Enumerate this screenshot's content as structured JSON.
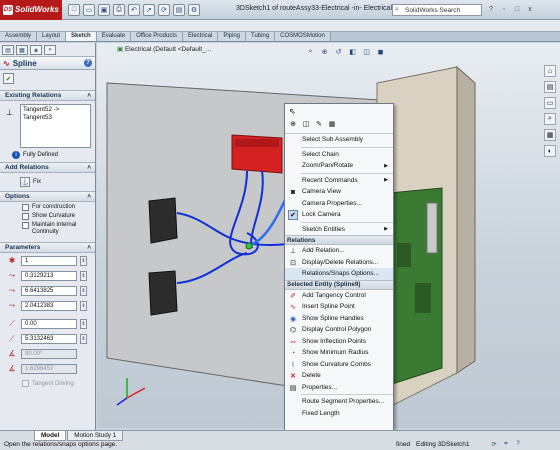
{
  "app": {
    "name": "SolidWorks",
    "document_title": "3DSketch1 of routeAssy33-Electrical -in- Electrical *",
    "search_placeholder": "SolidWorks Search",
    "window_controls": [
      "?",
      "-",
      "□",
      "x"
    ]
  },
  "command_tabs": [
    "Assembly",
    "Layout",
    "Sketch",
    "Evaluate",
    "Office Products",
    "Electrical",
    "Piping",
    "Tubing",
    "COSMOSMotion"
  ],
  "active_command_tab": "Sketch",
  "property_manager": {
    "title": "Spline",
    "existing_relations": {
      "title": "Existing Relations",
      "items": [
        "Tangent52 ->",
        "Tangent53"
      ],
      "status": "Fully Defined"
    },
    "add_relations": {
      "title": "Add Relations",
      "fix_label": "Fix"
    },
    "options": {
      "title": "Options",
      "items": [
        "For construction",
        "Show Curvature",
        "Maintain Internal Continuity"
      ]
    },
    "parameters": {
      "title": "Parameters",
      "fields": [
        "1",
        "0.3129213",
        "6.6413825",
        "2.0412383",
        "0.00",
        "5.3132463",
        "90.00°",
        "1.6296457"
      ],
      "tangent_driving": "Tangent Driving"
    }
  },
  "viewport": {
    "breadcrumb": "Electrical (Default <Default_..."
  },
  "context_menu": {
    "items_top": [
      {
        "label": "Select Sub Assembly"
      },
      {
        "label": "Select Chain"
      },
      {
        "label": "Zoom/Pan/Rotate",
        "submenu": true
      },
      {
        "label": "Recent Commands",
        "submenu": true
      },
      {
        "label": "Camera View"
      },
      {
        "label": "Camera Properties..."
      },
      {
        "label": "Lock Camera",
        "checked": true
      },
      {
        "label": "Sketch Entities",
        "submenu": true
      }
    ],
    "relations_header": "Relations",
    "relations_items": [
      "Add Relation...",
      "Display/Delete Relations...",
      "Relations/Snaps Options..."
    ],
    "entity_header": "Selected Entity (Spline9)",
    "entity_items": [
      "Add Tangency Control",
      "Insert Spline Point",
      "Show Spline Handles",
      "Display Control Polygon",
      "Show Inflection Points",
      "Show Minimum Radius",
      "Show Curvature Combs",
      "Delete",
      "Properties..."
    ],
    "bottom_items": [
      "Route Segment Properties...",
      "Fixed Length"
    ]
  },
  "status_bar": {
    "text": "Open the relations/snaps options page.",
    "tabs": [
      "Model",
      "Motion Study 1"
    ],
    "active_tab": "Model",
    "right_text_1": "fined",
    "right_text_2": "Editing 3DSketch1"
  }
}
